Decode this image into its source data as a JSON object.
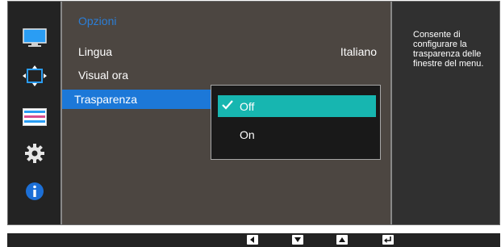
{
  "menu": {
    "title": "Opzioni",
    "items": [
      {
        "label": "Lingua",
        "value": "Italiano"
      },
      {
        "label": "Visual ora",
        "value": ""
      },
      {
        "label": "Trasparenza",
        "value": ""
      }
    ]
  },
  "dropdown": {
    "options": [
      {
        "label": "Off",
        "selected": true
      },
      {
        "label": "On",
        "selected": false
      }
    ]
  },
  "help": {
    "text": "Consente di configurare la trasparenza delle finestre del menu."
  },
  "sidebar": {
    "icons": [
      "picture-icon",
      "position-icon",
      "color-settings-icon",
      "gear-icon",
      "info-icon"
    ]
  },
  "navigation": {
    "buttons": [
      "left-arrow-icon",
      "down-arrow-icon",
      "up-arrow-icon",
      "enter-icon"
    ]
  },
  "colors": {
    "accent_blue": "#1c78d8",
    "title_blue": "#2b7ed6",
    "selected_option": "#17b6b0",
    "panel_bg": "#4c4641"
  }
}
